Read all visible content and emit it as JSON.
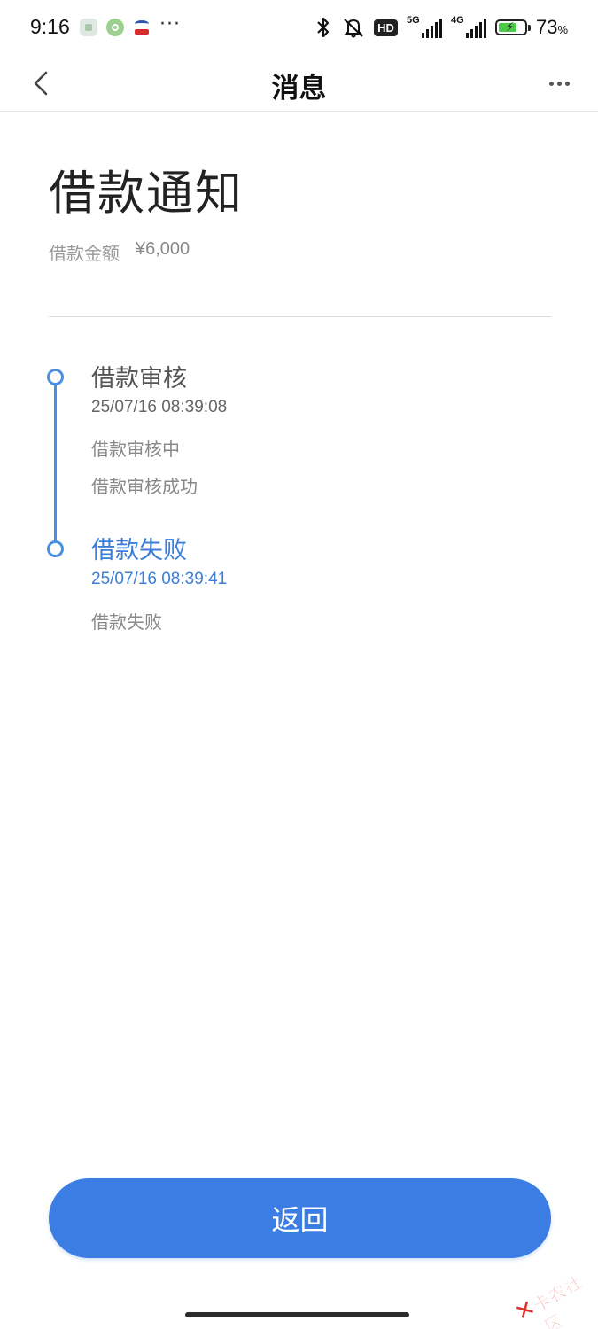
{
  "status_bar": {
    "time": "9:16",
    "more": "···",
    "hd": "HD",
    "net1": "5G",
    "net2": "4G",
    "battery_level": 0.73,
    "battery_value": "73",
    "battery_unit": "%"
  },
  "nav": {
    "title": "消息",
    "back_icon": "chevron-left-icon",
    "more_icon": "more-horizontal-icon"
  },
  "notice": {
    "title": "借款通知",
    "amount_label": "借款金额",
    "amount_value": "¥6,000"
  },
  "timeline": [
    {
      "title": "借款审核",
      "time": "25/07/16 08:39:08",
      "details": [
        "借款审核中",
        "借款审核成功"
      ]
    },
    {
      "title": "借款失败",
      "time": "25/07/16 08:39:41",
      "details": [
        "借款失败"
      ]
    }
  ],
  "colors": {
    "accent": "#3b7de3",
    "timeline": "#4a90e2",
    "watermark": "#e0302a"
  },
  "return_button": {
    "label": "返回"
  },
  "watermark": {
    "text": "卡农社区"
  }
}
